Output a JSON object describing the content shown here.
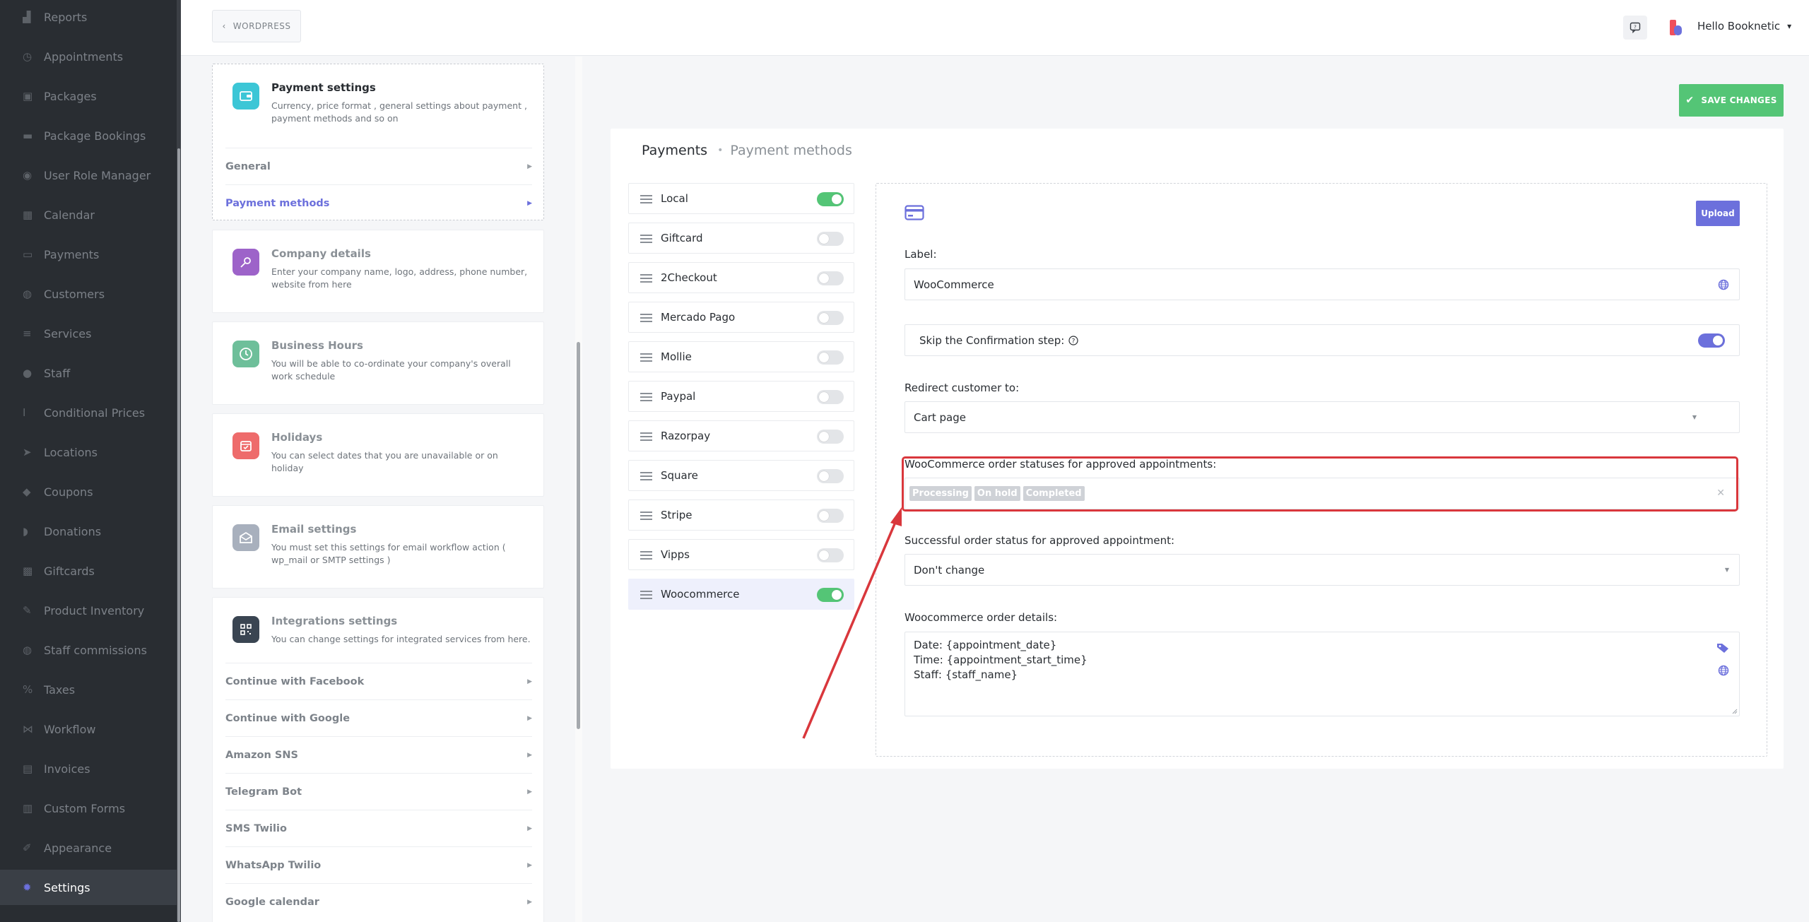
{
  "sidebar": {
    "items": [
      {
        "label": "Reports",
        "icon": "chart-icon",
        "active": false
      },
      {
        "label": "Appointments",
        "icon": "clock-icon",
        "active": false
      },
      {
        "label": "Packages",
        "icon": "package-icon",
        "active": false
      },
      {
        "label": "Package Bookings",
        "icon": "bed-icon",
        "active": false
      },
      {
        "label": "User Role Manager",
        "icon": "user-gear-icon",
        "active": false
      },
      {
        "label": "Calendar",
        "icon": "calendar-icon",
        "active": false
      },
      {
        "label": "Payments",
        "icon": "wallet-icon",
        "active": false
      },
      {
        "label": "Customers",
        "icon": "users-icon",
        "active": false
      },
      {
        "label": "Services",
        "icon": "list-icon",
        "active": false
      },
      {
        "label": "Staff",
        "icon": "user-icon",
        "active": false
      },
      {
        "label": "Conditional Prices",
        "icon": "cursor-icon",
        "active": false
      },
      {
        "label": "Locations",
        "icon": "location-arrow-icon",
        "active": false
      },
      {
        "label": "Coupons",
        "icon": "tag-icon",
        "active": false
      },
      {
        "label": "Donations",
        "icon": "donation-icon",
        "active": false
      },
      {
        "label": "Giftcards",
        "icon": "gift-icon",
        "active": false
      },
      {
        "label": "Product Inventory",
        "icon": "tools-icon",
        "active": false
      },
      {
        "label": "Staff commissions",
        "icon": "group-icon",
        "active": false
      },
      {
        "label": "Taxes",
        "icon": "percent-icon",
        "active": false
      },
      {
        "label": "Workflow",
        "icon": "workflow-icon",
        "active": false
      },
      {
        "label": "Invoices",
        "icon": "invoice-icon",
        "active": false
      },
      {
        "label": "Custom Forms",
        "icon": "forms-icon",
        "active": false
      },
      {
        "label": "Appearance",
        "icon": "brush-icon",
        "active": false
      },
      {
        "label": "Settings",
        "icon": "gear-icon",
        "active": true
      }
    ]
  },
  "topbar": {
    "back_label": "WORDPRESS",
    "user_label": "Hello Booknetic",
    "brand_colors": [
      "#f04f5c",
      "#6c70dc"
    ]
  },
  "settings": {
    "payment": {
      "title": "Payment settings",
      "desc": "Currency, price format , general settings about payment , payment methods and so on",
      "links": [
        "General",
        "Payment methods"
      ]
    },
    "company": {
      "title": "Company details",
      "desc": "Enter your company name, logo, address, phone number, website from here"
    },
    "hours": {
      "title": "Business Hours",
      "desc": "You will be able to co-ordinate your company's overall work schedule"
    },
    "holidays": {
      "title": "Holidays",
      "desc": "You can select dates that you are unavailable or on holiday"
    },
    "email": {
      "title": "Email settings",
      "desc": "You must set this settings for email workflow action ( wp_mail or SMTP settings )"
    },
    "integrations": {
      "title": "Integrations settings",
      "desc": "You can change settings for integrated services from here.",
      "links": [
        "Continue with Facebook",
        "Continue with Google",
        "Amazon SNS",
        "Telegram Bot",
        "SMS Twilio",
        "WhatsApp Twilio",
        "Google calendar"
      ]
    }
  },
  "main": {
    "save_label": "SAVE CHANGES",
    "breadcrumb": {
      "current": "Payments",
      "sub": "Payment methods"
    },
    "gateways": [
      {
        "name": "Local",
        "enabled": true
      },
      {
        "name": "Giftcard",
        "enabled": false
      },
      {
        "name": "2Checkout",
        "enabled": false
      },
      {
        "name": "Mercado Pago",
        "enabled": false
      },
      {
        "name": "Mollie",
        "enabled": false
      },
      {
        "name": "Paypal",
        "enabled": false
      },
      {
        "name": "Razorpay",
        "enabled": false
      },
      {
        "name": "Square",
        "enabled": false
      },
      {
        "name": "Stripe",
        "enabled": false
      },
      {
        "name": "Vipps",
        "enabled": false
      },
      {
        "name": "Woocommerce",
        "enabled": true,
        "selected": true
      }
    ],
    "form": {
      "upload_label": "Upload",
      "label_title": "Label:",
      "label_value": "WooCommerce",
      "skip_confirmation_label": "Skip the Confirmation step:",
      "skip_confirmation_enabled": true,
      "redirect_title": "Redirect customer to:",
      "redirect_value": "Cart page",
      "statuses_title": "WooCommerce order statuses for approved appointments:",
      "statuses": [
        "Processing",
        "On hold",
        "Completed"
      ],
      "success_status_title": "Successful order status for approved appointment:",
      "success_status_value": "Don't change",
      "details_title": "Woocommerce order details:",
      "details_lines": [
        "Date: {appointment_date}",
        "Time: {appointment_start_time}",
        "Staff: {staff_name}"
      ]
    }
  },
  "colors": {
    "accent": "#6c70dc",
    "success": "#54c576",
    "annotation": "#d9373c",
    "sidebar_bg": "#292d32"
  }
}
